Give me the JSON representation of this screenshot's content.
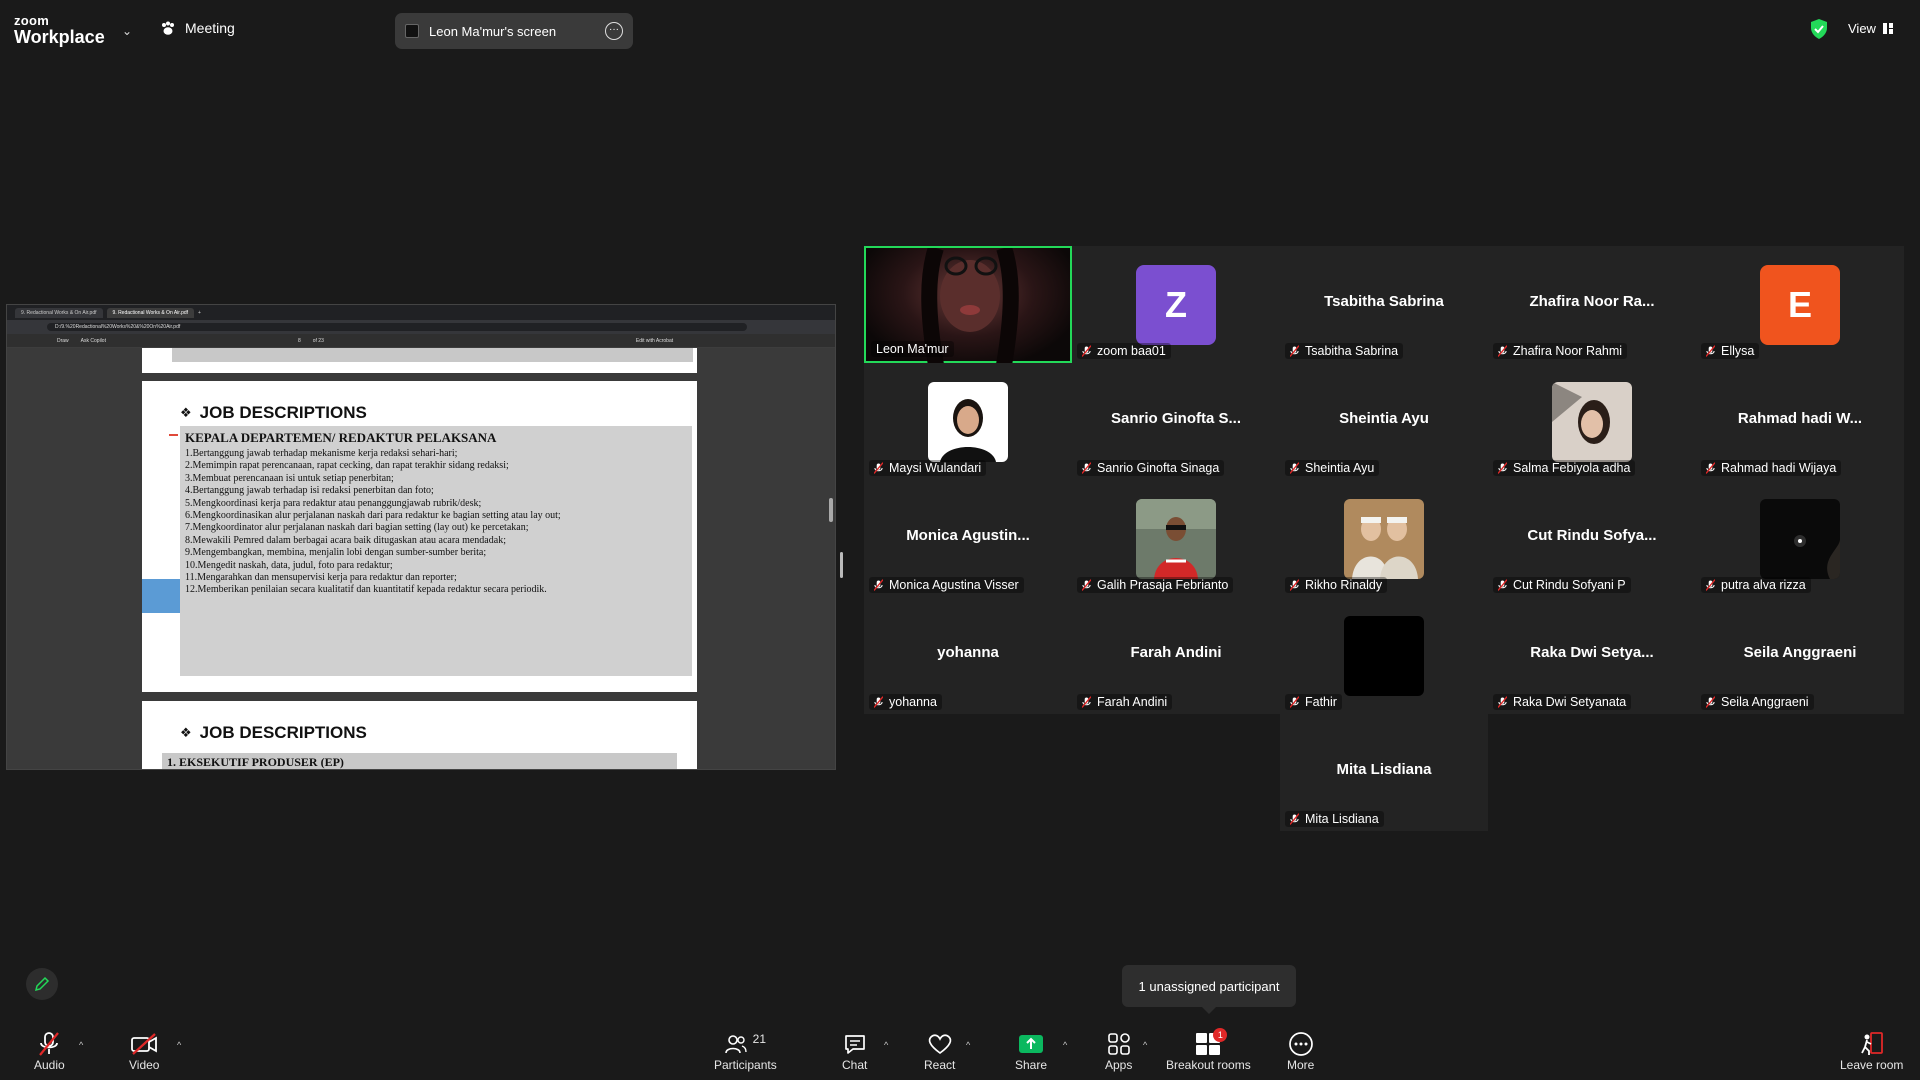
{
  "app": {
    "logo_line1": "zoom",
    "logo_line2": "Workplace"
  },
  "header": {
    "meeting_label": "Meeting",
    "screen_share_label": "Leon Ma'mur's screen",
    "view_label": "View"
  },
  "shared_screen": {
    "browser_tabs": [
      "9. Redactional Works & On Air.pdf",
      "9. Redactional Works & On Air.pdf"
    ],
    "address": "D:/9.%20Redactional%20Works%20&%20On%20Air.pdf",
    "toolbar": {
      "draw": "Draw",
      "ask": "Ask Copilot",
      "page": "8",
      "of": "of 23",
      "edit": "Edit with Acrobat"
    },
    "heading1": "JOB DESCRIPTIONS",
    "section_title": "KEPALA DEPARTEMEN/ REDAKTUR PELAKSANA",
    "items": [
      "1.Bertanggung jawab terhadap mekanisme kerja redaksi sehari-hari;",
      "2.Memimpin rapat perencanaan, rapat cecking, dan rapat terakhir sidang redaksi;",
      "3.Membuat perencanaan isi untuk setiap penerbitan;",
      "4.Bertanggung jawab terhadap isi redaksi penerbitan dan foto;",
      "5.Mengkoordinasi kerja para redaktur atau penanggungjawab rubrik/desk;",
      "6.Mengkoordinasikan alur perjalanan naskah dari para redaktur ke bagian setting atau lay out;",
      "7.Mengkoordinator alur perjalanan naskah dari bagian setting (lay out) ke percetakan;",
      "8.Mewakili Pemred dalam berbagai acara baik ditugaskan  atau  acara mendadak;",
      "9.Mengembangkan, membina, menjalin lobi dengan sumber-sumber berita;",
      "10.Mengedit naskah, data, judul, foto para redaktur;",
      "11.Mengarahkan dan mensupervisi kerja para redaktur dan reporter;",
      "12.Memberikan penilaian secara kualitatif dan kuantitatif kepada redaktur secara periodik."
    ],
    "heading2": "JOB DESCRIPTIONS",
    "next_section": "1. EKSEKUTIF PRODUSER (EP)"
  },
  "participants": [
    {
      "name": "Leon Ma'mur",
      "kind": "video",
      "active": true
    },
    {
      "name": "zoom baa01",
      "kind": "letter",
      "letter": "Z",
      "color": "#7b4fd0",
      "muted": true
    },
    {
      "name": "Tsabitha Sabrina",
      "display": "Tsabitha Sabrina",
      "kind": "name",
      "muted": true
    },
    {
      "name": "Zhafira Noor Rahmi",
      "display": "Zhafira Noor Ra...",
      "kind": "name",
      "muted": true
    },
    {
      "name": "Ellysa",
      "kind": "letter",
      "letter": "E",
      "color": "#f0541e",
      "muted": true
    },
    {
      "name": "Maysi Wulandari",
      "kind": "photo",
      "photo": "girl",
      "muted": true
    },
    {
      "name": "Sanrio Ginofta Sinaga",
      "display": "Sanrio Ginofta S...",
      "kind": "name",
      "muted": true
    },
    {
      "name": "Sheintia Ayu",
      "display": "Sheintia Ayu",
      "kind": "name",
      "muted": true
    },
    {
      "name": "Salma Febiyola adha",
      "kind": "photo",
      "photo": "woman",
      "muted": true
    },
    {
      "name": "Rahmad hadi Wijaya",
      "display": "Rahmad hadi W...",
      "kind": "name",
      "muted": true
    },
    {
      "name": "Monica Agustina Visser",
      "display": "Monica  Agustin...",
      "kind": "name",
      "muted": true
    },
    {
      "name": "Galih Prasaja Febrianto",
      "kind": "photo",
      "photo": "boy",
      "muted": true
    },
    {
      "name": "Rikho Rinaldy",
      "kind": "photo",
      "photo": "two",
      "muted": true
    },
    {
      "name": "Cut Rindu Sofyani P",
      "display": "Cut Rindu Sofya...",
      "kind": "name",
      "muted": true
    },
    {
      "name": "putra alva rizza",
      "kind": "photo",
      "photo": "dark",
      "muted": true
    },
    {
      "name": "yohanna",
      "display": "yohanna",
      "kind": "name",
      "muted": true
    },
    {
      "name": "Farah Andini",
      "display": "Farah Andini",
      "kind": "name",
      "muted": true
    },
    {
      "name": "Fathir",
      "kind": "photo",
      "photo": "black",
      "muted": true
    },
    {
      "name": "Raka Dwi Setyanata",
      "display": "Raka Dwi Setya...",
      "kind": "name",
      "muted": true
    },
    {
      "name": "Seila Anggraeni",
      "display": "Seila Anggraeni",
      "kind": "name",
      "muted": true
    },
    {
      "name": "Mita Lisdiana",
      "display": "Mita Lisdiana",
      "kind": "name",
      "muted": true
    }
  ],
  "tooltip": "1 unassigned participant",
  "toolbar": {
    "audio": "Audio",
    "video": "Video",
    "participants": "Participants",
    "participants_count": "21",
    "chat": "Chat",
    "react": "React",
    "share": "Share",
    "apps": "Apps",
    "breakout": "Breakout rooms",
    "breakout_badge": "1",
    "more": "More",
    "leave": "Leave room"
  },
  "colors": {
    "accent_green": "#23d959",
    "share_green": "#0bb85f",
    "mute_red": "#e02828",
    "bg": "#1a1a1a"
  }
}
